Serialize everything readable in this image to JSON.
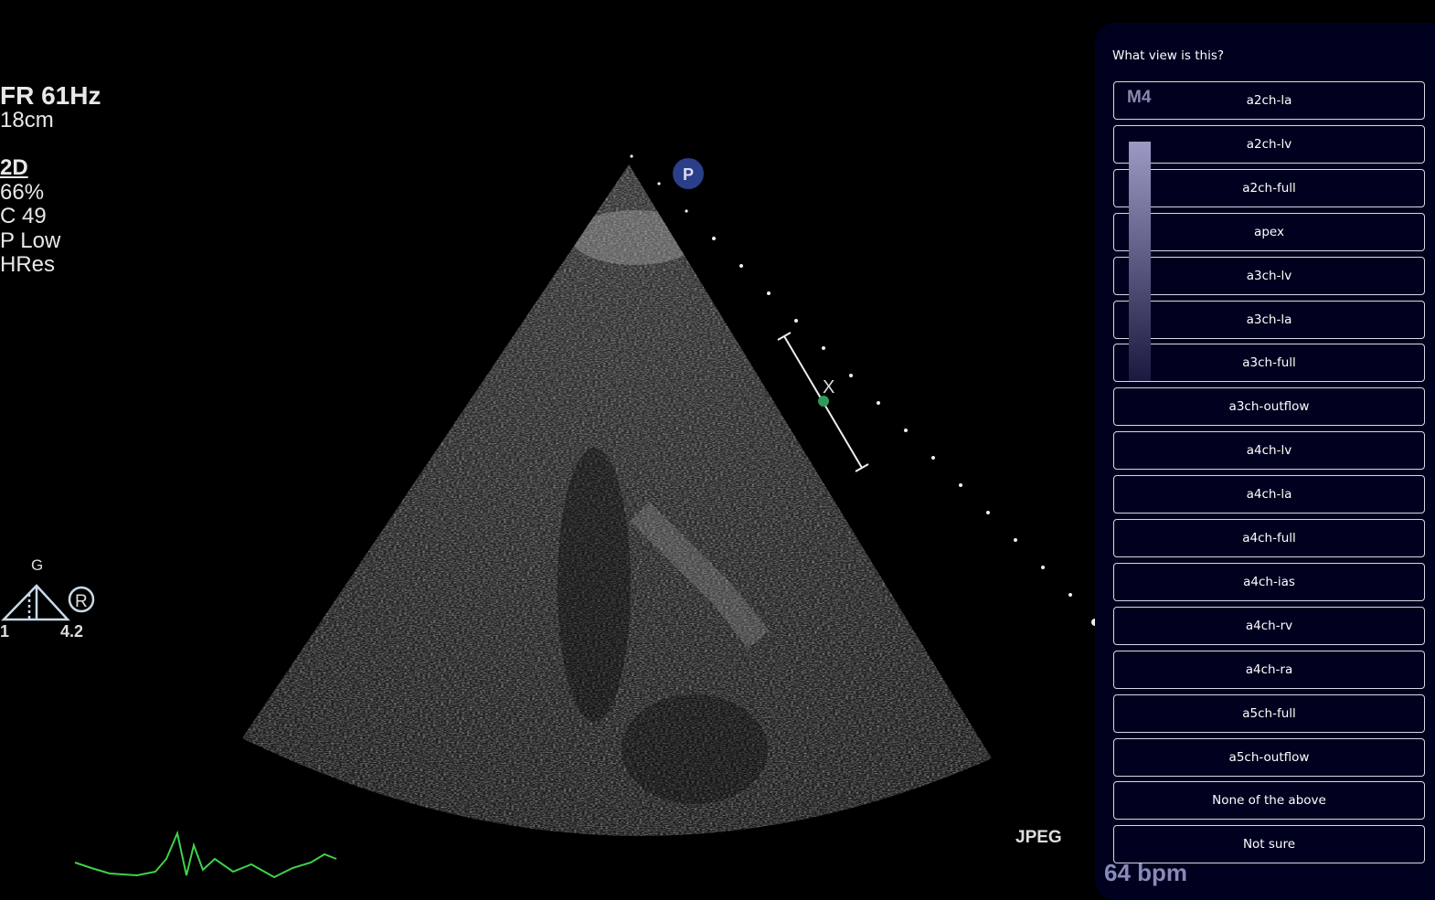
{
  "overlay": {
    "params": [
      "FR 61Hz",
      "18cm",
      "2D",
      "66%",
      "C 49",
      "P Low",
      "HRes"
    ],
    "probe_marker": "P",
    "scale_marker": "X",
    "gain_label": "G",
    "gain_left": "1",
    "gain_right": "4.2",
    "registered_mark": "®",
    "format": "JPEG",
    "heart_rate": "64 bpm",
    "probe_label": "M4",
    "ecg_color": "#3fd24a"
  },
  "panel": {
    "question": "What view is this?",
    "options": [
      "a2ch-la",
      "a2ch-lv",
      "a2ch-full",
      "apex",
      "a3ch-lv",
      "a3ch-la",
      "a3ch-full",
      "a3ch-outflow",
      "a4ch-lv",
      "a4ch-la",
      "a4ch-full",
      "a4ch-ias",
      "a4ch-rv",
      "a4ch-ra",
      "a5ch-full",
      "a5ch-outflow",
      "None of the above",
      "Not sure"
    ]
  }
}
